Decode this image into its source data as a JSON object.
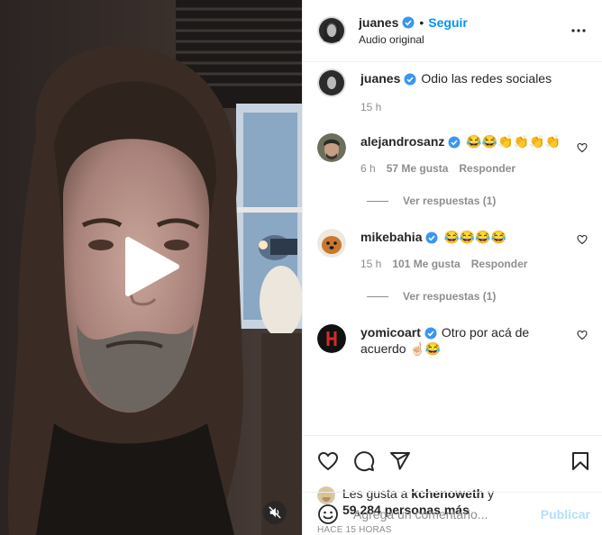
{
  "header": {
    "username": "juanes",
    "separator": "•",
    "follow_label": "Seguir",
    "audio_label": "Audio original"
  },
  "caption": {
    "username": "juanes",
    "text": "Odio las redes sociales",
    "time": "15 h"
  },
  "comments": [
    {
      "username": "alejandrosanz",
      "text": "😂😂👏👏👏👏",
      "time": "6 h",
      "likes": "57 Me gusta",
      "reply_label": "Responder",
      "view_replies": "Ver respuestas (1)"
    },
    {
      "username": "mikebahia",
      "text": "😂😂😂😂",
      "time": "15 h",
      "likes": "101 Me gusta",
      "reply_label": "Responder",
      "view_replies": "Ver respuestas (1)"
    },
    {
      "username": "yomicoart",
      "text": "Otro por acá de acuerdo ☝🏻😂"
    }
  ],
  "likes": {
    "prefix": "Les gusta a",
    "user": "kchenoweth",
    "conj": "y",
    "others": "59,284 personas más"
  },
  "timestamp": "Hace 15 horas",
  "add_comment": {
    "placeholder": "Agrega un comentario...",
    "post_label": "Publicar"
  },
  "colors": {
    "accent": "#0095f6",
    "verified": "#3897f0",
    "muted": "#8e8e8e",
    "post_disabled": "#b2dffc"
  },
  "icons": [
    "play-icon",
    "mute-icon",
    "more-icon",
    "verified-icon",
    "heart-icon",
    "comment-icon",
    "share-icon",
    "save-icon",
    "emoji-icon"
  ]
}
